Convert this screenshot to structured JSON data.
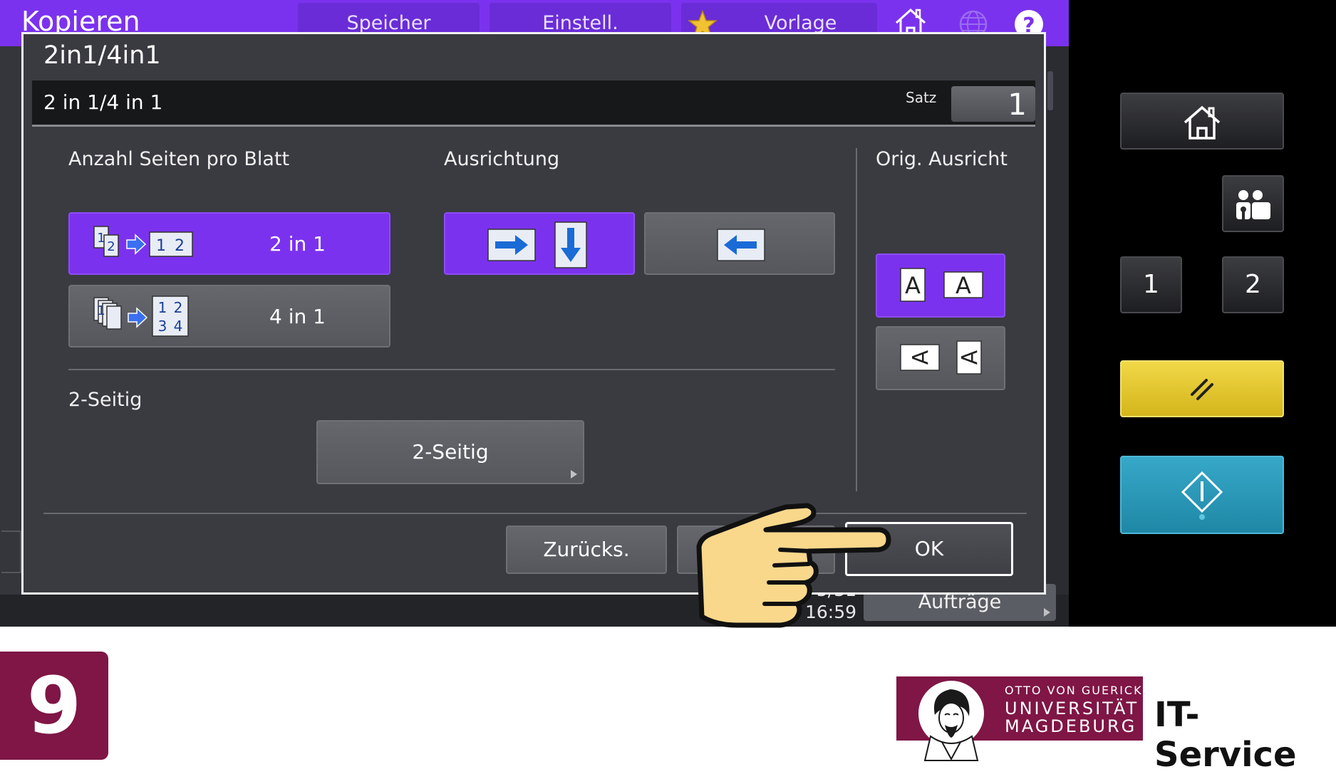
{
  "app": {
    "title": "Kopieren",
    "tabs": [
      "Speicher",
      "Einstell.",
      "Vorlage"
    ],
    "icons": [
      "favorite-star-icon",
      "home-icon",
      "globe-icon",
      "help-icon"
    ]
  },
  "dialog": {
    "title": "2in1/4in1",
    "subheader": "2 in 1/4 in 1",
    "satz_label": "Satz",
    "satz_value": "1",
    "pages_per_sheet": {
      "label": "Anzahl Seiten pro Blatt",
      "options": [
        {
          "label": "2 in 1",
          "selected": true
        },
        {
          "label": "4 in 1",
          "selected": false
        }
      ]
    },
    "orientation": {
      "label": "Ausrichtung",
      "options": [
        {
          "name": "left-to-right-top-to-bottom",
          "selected": true
        },
        {
          "name": "right-to-left",
          "selected": false
        }
      ]
    },
    "original_orientation": {
      "label": "Orig. Ausricht",
      "options": [
        {
          "glyph": "A",
          "name": "upright",
          "selected": true
        },
        {
          "glyph": "A",
          "name": "rotated",
          "selected": false
        }
      ]
    },
    "duplex": {
      "label": "2-Seitig",
      "button": "2-Seitig"
    },
    "footer": {
      "reset": "Zurücks.",
      "ok": "OK"
    }
  },
  "status": {
    "date_fragment": "5/31",
    "time": "16:59",
    "jobs_button": "Aufträge"
  },
  "panel": {
    "buttons": [
      "home-icon",
      "user-management-icon",
      "1",
      "2",
      "reset-icon",
      "start-icon"
    ]
  },
  "branding": {
    "step_number": "9",
    "logo_line1": "OTTO VON GUERICKE",
    "logo_line2": "UNIVERSITÄT",
    "logo_line3": "MAGDEBURG",
    "service": "IT-Service",
    "brand_color": "#7f1645"
  },
  "colors": {
    "accent": "#7b32ee",
    "reset_yellow": "#e5c82e",
    "start_blue": "#2b98b8"
  }
}
